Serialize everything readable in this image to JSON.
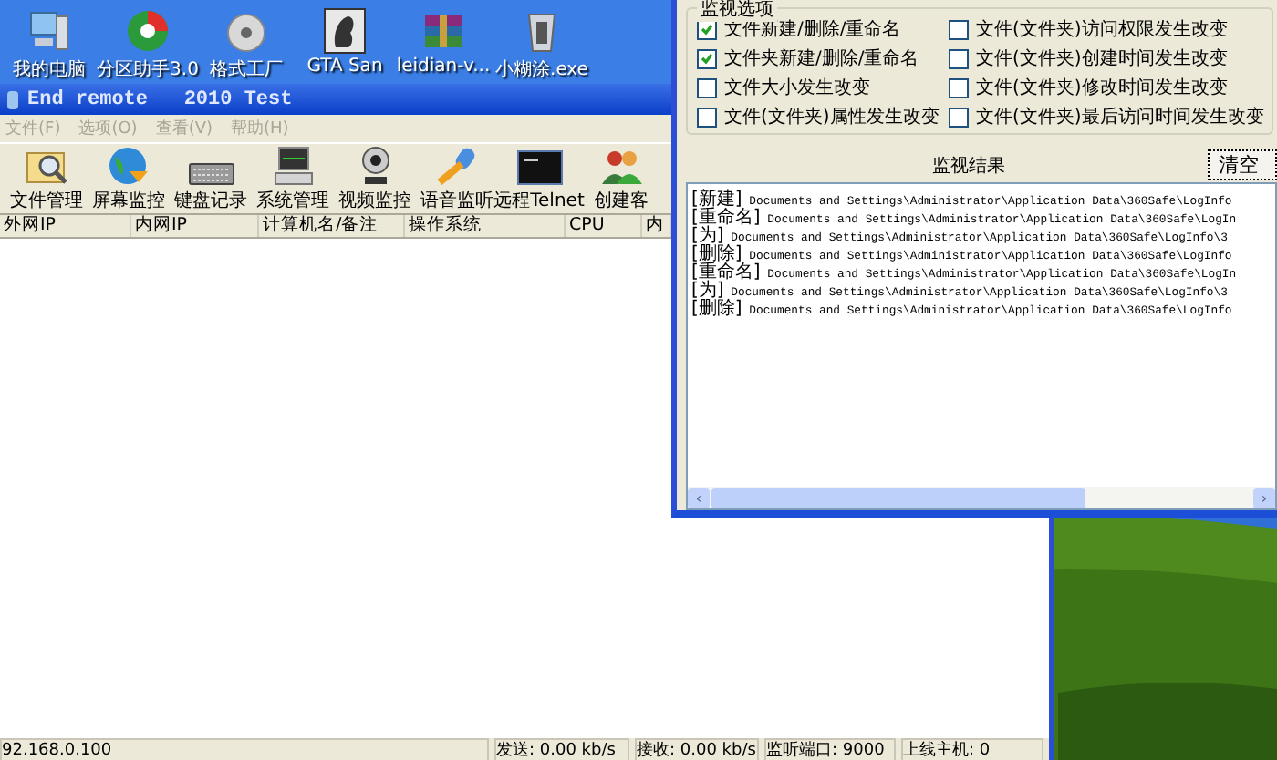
{
  "desktop_icons": [
    {
      "label": "我的电脑",
      "kind": "computer"
    },
    {
      "label": "分区助手3.0",
      "kind": "disk"
    },
    {
      "label": "格式工厂",
      "kind": "factory"
    },
    {
      "label": "GTA San",
      "kind": "game"
    },
    {
      "label": "leidian-v...",
      "kind": "archive"
    },
    {
      "label": "小糊涂.exe",
      "kind": "trash"
    }
  ],
  "main_window": {
    "title": "End remote   2010 Test",
    "menu": [
      {
        "label": "文件(F)",
        "disabled": true
      },
      {
        "label": "选项(O)",
        "disabled": true
      },
      {
        "label": "查看(V)",
        "disabled": true
      },
      {
        "label": "帮助(H)",
        "disabled": true
      }
    ],
    "toolbar": [
      {
        "label": "文件管理",
        "kind": "folder"
      },
      {
        "label": "屏幕监控",
        "kind": "globe"
      },
      {
        "label": "键盘记录",
        "kind": "keyboard"
      },
      {
        "label": "系统管理",
        "kind": "monitor"
      },
      {
        "label": "视频监控",
        "kind": "webcam"
      },
      {
        "label": "语音监听",
        "kind": "speaker"
      },
      {
        "label": "远程Telnet",
        "kind": "console"
      },
      {
        "label": "创建客",
        "kind": "users"
      }
    ],
    "columns": [
      "外网IP",
      "内网IP",
      "计算机名/备注",
      "操作系统",
      "CPU",
      "内"
    ],
    "status_bar": [
      "92.168.0.100",
      "发送: 0.00 kb/s",
      "接收: 0.00 kb/s",
      "监听端口: 9000",
      "上线主机: 0"
    ]
  },
  "monitor_window": {
    "options_title": "监视选项",
    "options": [
      {
        "label": "文件新建/删除/重命名",
        "checked": true
      },
      {
        "label": "文件(文件夹)访问权限发生改变",
        "checked": false
      },
      {
        "label": "文件夹新建/删除/重命名",
        "checked": true
      },
      {
        "label": "文件(文件夹)创建时间发生改变",
        "checked": false
      },
      {
        "label": "文件大小发生改变",
        "checked": false
      },
      {
        "label": "文件(文件夹)修改时间发生改变",
        "checked": false
      },
      {
        "label": "文件(文件夹)属性发生改变",
        "checked": false
      },
      {
        "label": "文件(文件夹)最后访问时间发生改变",
        "checked": false
      }
    ],
    "results_title": "监视结果",
    "clear_button": "清空",
    "scroll_arrows": [
      "‹",
      "›"
    ],
    "log": [
      {
        "tag": "[新建]",
        "path": "Documents and Settings\\Administrator\\Application Data\\360Safe\\LogInfo"
      },
      {
        "tag": "[重命名]",
        "path": "Documents and Settings\\Administrator\\Application Data\\360Safe\\LogIn"
      },
      {
        "tag": "[为]",
        "path": "Documents and Settings\\Administrator\\Application Data\\360Safe\\LogInfo\\3"
      },
      {
        "tag": "[删除]",
        "path": "Documents and Settings\\Administrator\\Application Data\\360Safe\\LogInfo"
      },
      {
        "tag": "[重命名]",
        "path": "Documents and Settings\\Administrator\\Application Data\\360Safe\\LogIn"
      },
      {
        "tag": "[为]",
        "path": "Documents and Settings\\Administrator\\Application Data\\360Safe\\LogInfo\\3"
      },
      {
        "tag": "[删除]",
        "path": "Documents and Settings\\Administrator\\Application Data\\360Safe\\LogInfo"
      }
    ]
  }
}
